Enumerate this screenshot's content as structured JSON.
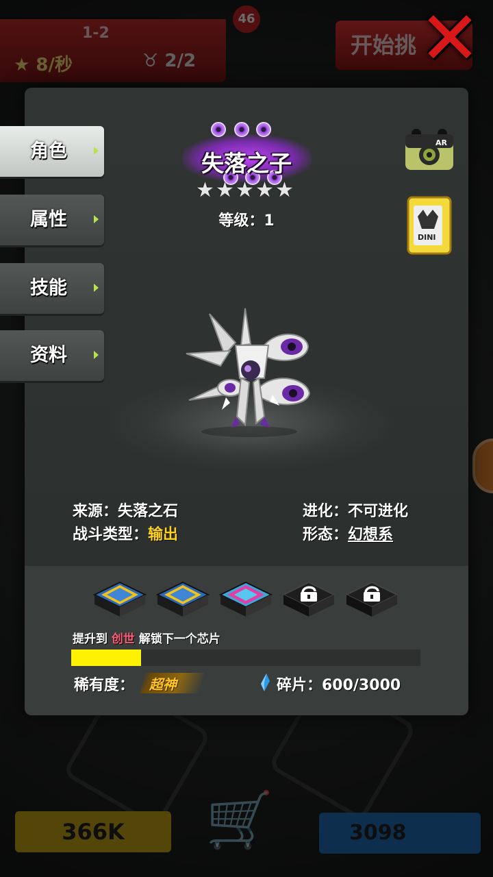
{
  "background_hud": {
    "level_badge": "46",
    "stage_name": "1-2",
    "rate": "8/秒",
    "pets": "2/2",
    "start_button": "开始挑",
    "gold": "366K",
    "gems": "3098"
  },
  "close_button": {
    "icon": "close-icon",
    "color": "#d81818"
  },
  "tabs": [
    {
      "label": "角色",
      "active": true
    },
    {
      "label": "属性",
      "active": false
    },
    {
      "label": "技能",
      "active": false
    },
    {
      "label": "资料",
      "active": false
    }
  ],
  "pet": {
    "name": "失落之子",
    "stars": 5,
    "level_text": "等级：1"
  },
  "icons": {
    "ar_camera": "AR",
    "card": "DINI"
  },
  "info": {
    "source_label": "来源：",
    "source_value": "失落之石",
    "evolution_label": "进化：",
    "evolution_value": "不可进化",
    "battle_type_label": "战斗类型：",
    "battle_type_value": "输出",
    "form_label": "形态：",
    "form_value": "幻想系"
  },
  "chips": [
    {
      "state": "unlocked-gold",
      "icon": "chip-icon"
    },
    {
      "state": "unlocked-gold",
      "icon": "chip-icon"
    },
    {
      "state": "unlocked-pink",
      "icon": "chip-icon"
    },
    {
      "state": "locked",
      "icon": "lock-icon"
    },
    {
      "state": "locked",
      "icon": "lock-icon"
    }
  ],
  "unlock_hint": {
    "prefix": "提升到 ",
    "highlight": "创世",
    "suffix": " 解锁下一个芯片"
  },
  "progress": {
    "fraction": 0.2,
    "color": "#fff200"
  },
  "rarity": {
    "label": "稀有度：",
    "value": "超神"
  },
  "shards": {
    "text": "碎片：600/3000"
  },
  "colors": {
    "accent_purple": "#b13ff0",
    "highlight_yellow": "#ffd31d",
    "highlight_pink": "#ff5a78"
  }
}
